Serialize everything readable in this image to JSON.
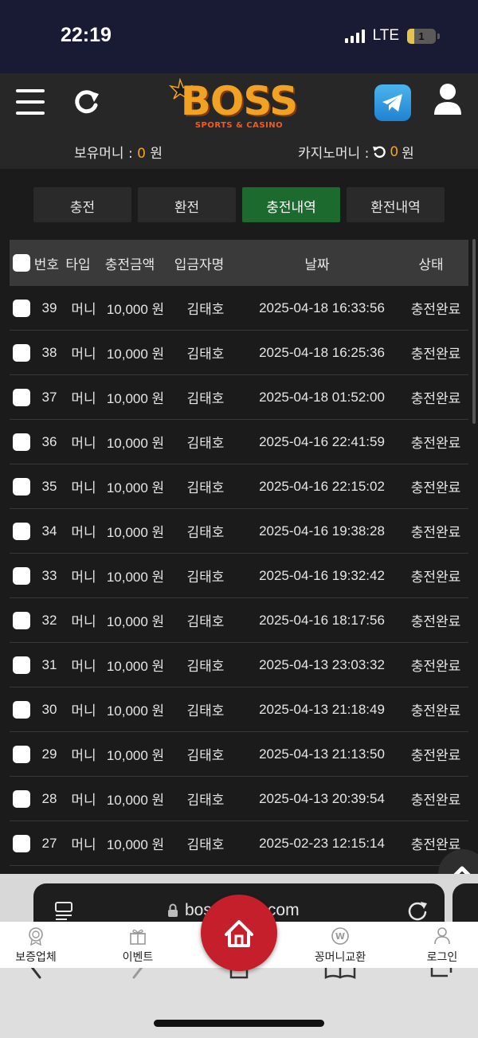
{
  "status_bar": {
    "time": "22:19",
    "network": "LTE",
    "battery": "1"
  },
  "header": {
    "logo_text": "BOSS",
    "logo_sub": "SPORTS & CASINO",
    "balance_label": "보유머니 : ",
    "balance_value": "0",
    "balance_unit": " 원",
    "casino_label": "카지노머니 : ",
    "casino_value": "0",
    "casino_unit": " 원"
  },
  "tabs": [
    {
      "label": "충전",
      "active": false
    },
    {
      "label": "환전",
      "active": false
    },
    {
      "label": "충전내역",
      "active": true
    },
    {
      "label": "환전내역",
      "active": false
    }
  ],
  "table": {
    "columns": [
      "번호",
      "타입",
      "충전금액",
      "입금자명",
      "날짜",
      "상태"
    ],
    "rows": [
      {
        "no": "39",
        "type": "머니",
        "amount": "10,000 원",
        "name": "김태호",
        "date": "2025-04-18 16:33:56",
        "status": "충전완료"
      },
      {
        "no": "38",
        "type": "머니",
        "amount": "10,000 원",
        "name": "김태호",
        "date": "2025-04-18 16:25:36",
        "status": "충전완료"
      },
      {
        "no": "37",
        "type": "머니",
        "amount": "10,000 원",
        "name": "김태호",
        "date": "2025-04-18 01:52:00",
        "status": "충전완료"
      },
      {
        "no": "36",
        "type": "머니",
        "amount": "10,000 원",
        "name": "김태호",
        "date": "2025-04-16 22:41:59",
        "status": "충전완료"
      },
      {
        "no": "35",
        "type": "머니",
        "amount": "10,000 원",
        "name": "김태호",
        "date": "2025-04-16 22:15:02",
        "status": "충전완료"
      },
      {
        "no": "34",
        "type": "머니",
        "amount": "10,000 원",
        "name": "김태호",
        "date": "2025-04-16 19:38:28",
        "status": "충전완료"
      },
      {
        "no": "33",
        "type": "머니",
        "amount": "10,000 원",
        "name": "김태호",
        "date": "2025-04-16 19:32:42",
        "status": "충전완료"
      },
      {
        "no": "32",
        "type": "머니",
        "amount": "10,000 원",
        "name": "김태호",
        "date": "2025-04-16 18:17:56",
        "status": "충전완료"
      },
      {
        "no": "31",
        "type": "머니",
        "amount": "10,000 원",
        "name": "김태호",
        "date": "2025-04-13 23:03:32",
        "status": "충전완료"
      },
      {
        "no": "30",
        "type": "머니",
        "amount": "10,000 원",
        "name": "김태호",
        "date": "2025-04-13 21:18:49",
        "status": "충전완료"
      },
      {
        "no": "29",
        "type": "머니",
        "amount": "10,000 원",
        "name": "김태호",
        "date": "2025-04-13 21:13:50",
        "status": "충전완료"
      },
      {
        "no": "28",
        "type": "머니",
        "amount": "10,000 원",
        "name": "김태호",
        "date": "2025-04-13 20:39:54",
        "status": "충전완료"
      },
      {
        "no": "27",
        "type": "머니",
        "amount": "10,000 원",
        "name": "김태호",
        "date": "2025-02-23 12:15:14",
        "status": "충전완료"
      }
    ]
  },
  "browser": {
    "url": "boss-6594.com"
  },
  "bottom_nav": [
    {
      "label": "보증업체",
      "icon": "medal-icon"
    },
    {
      "label": "이벤트",
      "icon": "gift-icon"
    },
    {
      "label": "",
      "icon": "home-icon"
    },
    {
      "label": "꽁머니교환",
      "icon": "won-coin-icon"
    },
    {
      "label": "로그인",
      "icon": "user-icon"
    }
  ],
  "colors": {
    "accent": "#f2a223",
    "active_tab": "#1c6a2d",
    "home_button": "#c41f2a",
    "status_bar": "#191a33"
  }
}
